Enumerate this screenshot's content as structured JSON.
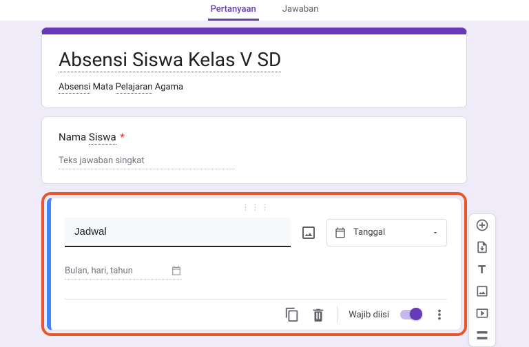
{
  "tabs": {
    "questions": "Pertanyaan",
    "responses": "Jawaban"
  },
  "form": {
    "title": "Absensi Siswa Kelas V SD",
    "description_prefix": "Absensi",
    "description_mid": "Mata",
    "description_word": "Pelajaran",
    "description_suffix": "Agama"
  },
  "q1": {
    "label_prefix": "Nama",
    "label_word": "Siswa",
    "required_mark": "*",
    "placeholder": "Teks jawaban singkat"
  },
  "q2": {
    "title": "Jadwal",
    "type_label": "Tanggal",
    "date_placeholder": "Bulan, hari, tahun"
  },
  "footer": {
    "required_label": "Wajib diisi"
  }
}
